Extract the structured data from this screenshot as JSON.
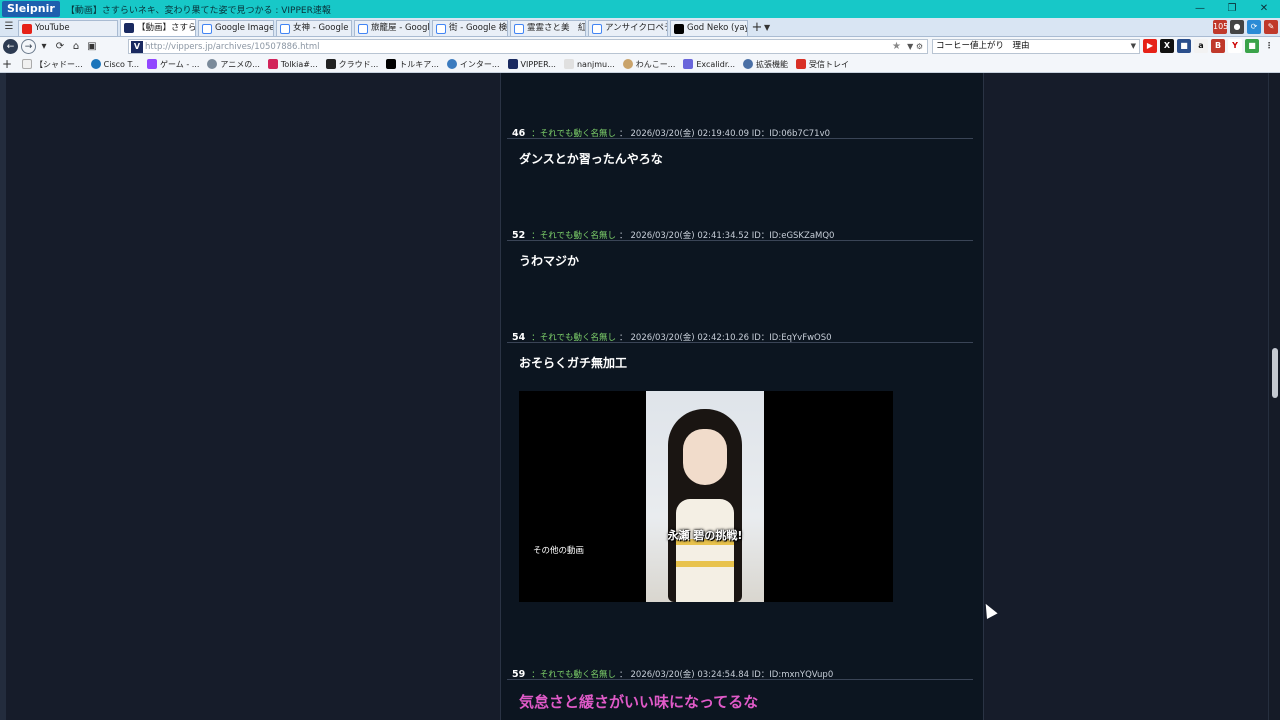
{
  "window": {
    "app_name": "Sleipnir",
    "title": "【動画】さすらいネキ、変わり果てた姿で見つかる : VIPPER速報"
  },
  "tabs": [
    {
      "label": "YouTube",
      "icon": "youtube-icon",
      "color": "#e62117"
    },
    {
      "label": "【動画】さすらいネ...",
      "icon": "vipper-icon",
      "color": "#1a2a60",
      "active": true
    },
    {
      "label": "Google Image R...",
      "icon": "google-icon",
      "color": "#4285f4"
    },
    {
      "label": "女神 - Google ...",
      "icon": "google-icon",
      "color": "#4285f4"
    },
    {
      "label": "旅籠屋 - Googl...",
      "icon": "google-icon",
      "color": "#4285f4"
    },
    {
      "label": "街 - Google 検索",
      "icon": "google-icon",
      "color": "#4285f4"
    },
    {
      "label": "霊霊さと美　紅...",
      "icon": "google-icon",
      "color": "#4285f4"
    },
    {
      "label": "アンサイクロペディ...",
      "icon": "google-icon",
      "color": "#4285f4"
    },
    {
      "label": "God Neko (yaye...",
      "icon": "x-icon",
      "color": "#000000"
    }
  ],
  "nav": {
    "url": "http://vippers.jp/archives/10507886.html",
    "search_value": "コーヒー値上がり　理由"
  },
  "bookmarks": [
    {
      "label": "【シャドー...",
      "color": "#f0f0f0"
    },
    {
      "label": "Cisco T...",
      "color": "#1b75bb"
    },
    {
      "label": "ゲーム - ...",
      "color": "#9146ff"
    },
    {
      "label": "アニメの...",
      "color": "#7a8a9a"
    },
    {
      "label": "Tolkia#...",
      "color": "#d2245a"
    },
    {
      "label": "クラウド...",
      "color": "#222222"
    },
    {
      "label": "トルキア...",
      "color": "#000000"
    },
    {
      "label": "インター...",
      "color": "#3b7bbf"
    },
    {
      "label": "VIPPER...",
      "color": "#1a2a60"
    },
    {
      "label": "nanjmu...",
      "color": "#e0e0e0"
    },
    {
      "label": "わんこー...",
      "color": "#c9a36b"
    },
    {
      "label": "Excalidr...",
      "color": "#6965db"
    },
    {
      "label": "拡張機能",
      "color": "#4a6fa5"
    },
    {
      "label": "受信トレイ",
      "color": "#d93025"
    }
  ],
  "posts": [
    {
      "num": "46",
      "name": "：それでも動く名無し",
      "sep": "：",
      "date": "2026/03/20(金) 02:19:40.09",
      "id_label": "ID：",
      "id": "ID:06b7C71v0",
      "body": "ダンスとか習ったんやろな"
    },
    {
      "num": "52",
      "name": "：それでも動く名無し",
      "sep": "：",
      "date": "2026/03/20(金) 02:41:34.52",
      "id_label": "ID：",
      "id": "ID:eGSKZaMQ0",
      "body": "うわマジか"
    },
    {
      "num": "54",
      "name": "：それでも動く名無し",
      "sep": "：",
      "date": "2026/03/20(金) 02:42:10.26",
      "id_label": "ID：",
      "id": "ID:EqYvFwOS0",
      "body": "おそらくガチ無加工"
    },
    {
      "num": "59",
      "name": "：それでも動く名無し",
      "sep": "：",
      "date": "2026/03/20(金) 03:24:54.84",
      "id_label": "ID：",
      "id": "ID:mxnYQVup0",
      "body": "気怠さと緩さがいい味になってるな"
    }
  ],
  "video": {
    "side_label": "その他の動画",
    "caption": "永瀬 碧の挑戦!"
  }
}
